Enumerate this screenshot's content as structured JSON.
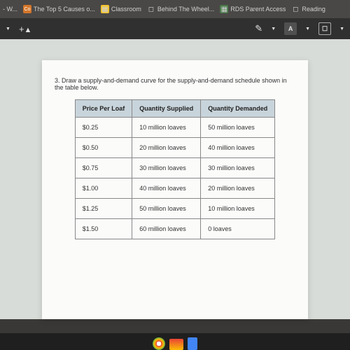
{
  "bookmarks": [
    {
      "label": " - W...",
      "icon": ""
    },
    {
      "label": "The Top 5 Causes o...",
      "icon": "Co"
    },
    {
      "label": "Classroom",
      "icon": "▦"
    },
    {
      "label": "Behind The Wheel...",
      "icon": "◻"
    },
    {
      "label": "RDS Parent Access",
      "icon": "▦"
    },
    {
      "label": "Reading",
      "icon": "◻"
    }
  ],
  "toolbar": {
    "left_icon": "▼",
    "add_person": "+👤",
    "pen": "✎",
    "a_btn": "A",
    "box_btn": "☐"
  },
  "question": "3. Draw a supply-and-demand curve for the supply-and-demand schedule shown in the table below.",
  "table": {
    "headers": [
      "Price Per Loaf",
      "Quantity Supplied",
      "Quantity Demanded"
    ],
    "rows": [
      [
        "$0.25",
        "10 million loaves",
        "50 million loaves"
      ],
      [
        "$0.50",
        "20 million loaves",
        "40 million loaves"
      ],
      [
        "$0.75",
        "30 million loaves",
        "30 million loaves"
      ],
      [
        "$1.00",
        "40 million loaves",
        "20 million loaves"
      ],
      [
        "$1.25",
        "50 million loaves",
        "10 million loaves"
      ],
      [
        "$1.50",
        "60 million loaves",
        "0 loaves"
      ]
    ]
  },
  "taskbar_colors": [
    "#e84a27",
    "#ea4335",
    "#4285f4"
  ]
}
